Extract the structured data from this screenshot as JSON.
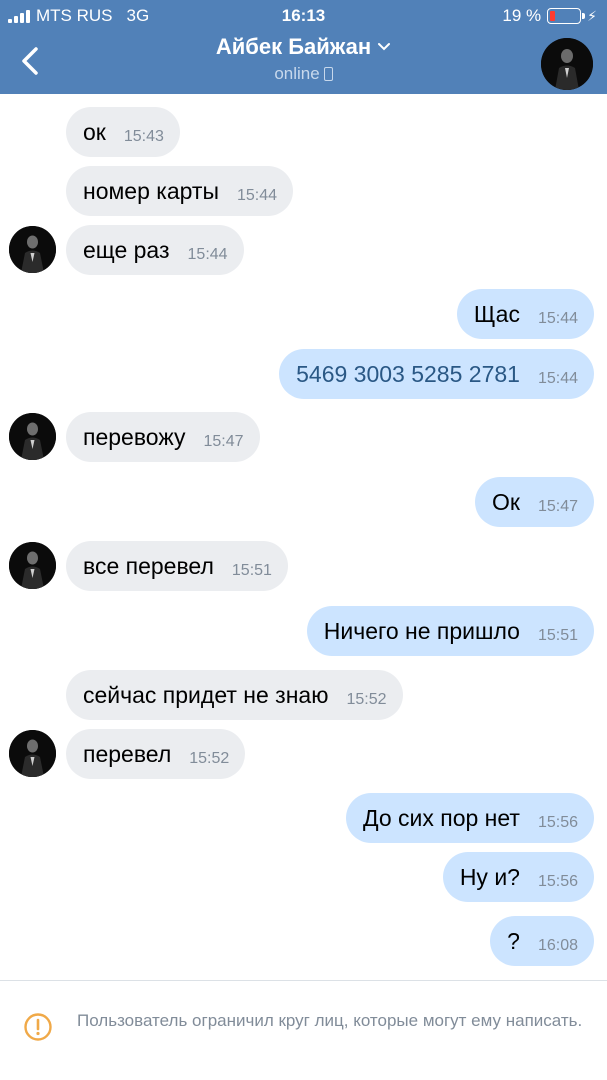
{
  "status_bar": {
    "carrier": "MTS RUS",
    "network": "3G",
    "time": "16:13",
    "battery_percent_label": "19 %",
    "battery_level": 0.19
  },
  "header": {
    "contact_name": "Айбек Байжан",
    "status": "online",
    "accent_color": "#5181b8"
  },
  "messages": [
    {
      "dir": "in",
      "text": "ок",
      "time": "15:43"
    },
    {
      "dir": "in",
      "text": "номер карты",
      "time": "15:44"
    },
    {
      "dir": "in",
      "text": "еще раз",
      "time": "15:44"
    },
    {
      "dir": "out",
      "text": "Щас",
      "time": "15:44"
    },
    {
      "dir": "out",
      "text": "5469 3003 5285 2781",
      "time": "15:44"
    },
    {
      "dir": "in",
      "text": "перевожу",
      "time": "15:47"
    },
    {
      "dir": "out",
      "text": "Ок",
      "time": "15:47"
    },
    {
      "dir": "in",
      "text": "все перевел",
      "time": "15:51"
    },
    {
      "dir": "out",
      "text": "Ничего не пришло",
      "time": "15:51"
    },
    {
      "dir": "in",
      "text": "сейчас придет не знаю",
      "time": "15:52"
    },
    {
      "dir": "in",
      "text": "перевел",
      "time": "15:52"
    },
    {
      "dir": "out",
      "text": "До сих пор нет",
      "time": "15:56"
    },
    {
      "dir": "out",
      "text": "Ну и?",
      "time": "15:56"
    },
    {
      "dir": "out",
      "text": "?",
      "time": "16:08"
    }
  ],
  "footer": {
    "notice": "Пользователь ограничил круг лиц, которые могут ему написать.",
    "icon": "warning-circle-icon",
    "icon_color": "#f0a948"
  }
}
